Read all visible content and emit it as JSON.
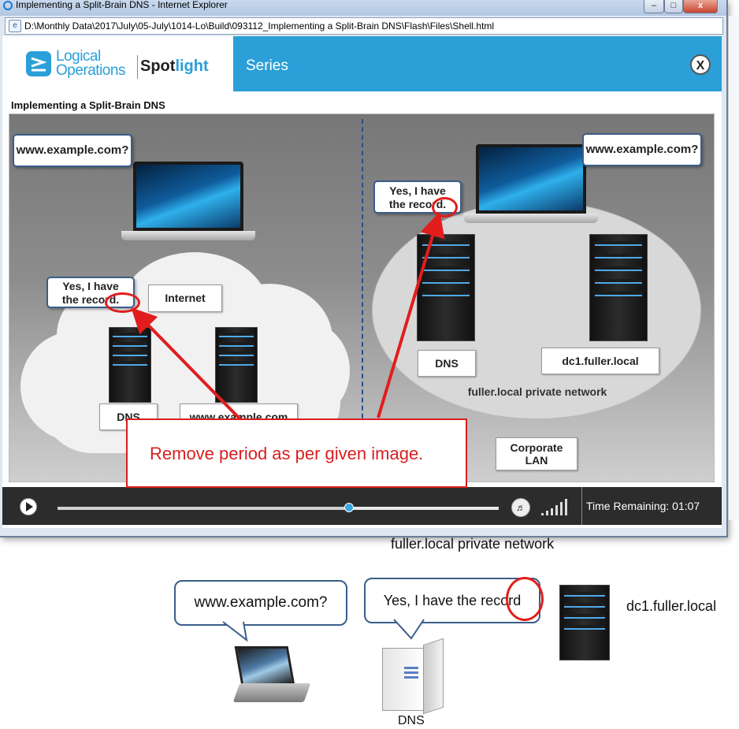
{
  "window": {
    "title": "Implementing a Split-Brain DNS - Internet Explorer",
    "address": "D:\\Monthly Data\\2017\\July\\05-July\\1014-Lo\\Build\\093112_Implementing a Split-Brain DNS\\Flash\\Files\\Shell.html",
    "buttons": {
      "minimize": "–",
      "maximize": "□",
      "close": "x"
    }
  },
  "player": {
    "logo": {
      "line1": "Logical",
      "line2": "Operations",
      "product_plain": "Spot",
      "product_accent": "light"
    },
    "header": {
      "series": "Series",
      "close": "X"
    },
    "course_title": "Implementing a Split-Brain DNS",
    "stage": {
      "left": {
        "query_bubble": "www.example.com?",
        "answer_bubble_line1": "Yes, I have",
        "answer_bubble_line2": "the record.",
        "internet_label": "Internet",
        "dns_label": "DNS",
        "server_label": "www.example.com"
      },
      "right": {
        "query_bubble": "www.example.com?",
        "answer_bubble_line1": "Yes, I have",
        "answer_bubble_line2": "the record.",
        "dns_label": "DNS",
        "dc_label": "dc1.fuller.local",
        "network_label": "fuller.local private network",
        "corp_line1": "Corporate",
        "corp_line2": "LAN"
      }
    },
    "controls": {
      "progress_fraction": 0.66,
      "time_remaining": "Time Remaining: 01:07"
    }
  },
  "annotation": {
    "text": "Remove period as per given image.",
    "color": "#d81f1f"
  },
  "reference": {
    "network_label": "fuller.local private network",
    "query_bubble": "www.example.com?",
    "answer_bubble": "Yes, I have the record",
    "dc_label": "dc1.fuller.local",
    "dns_label": "DNS"
  },
  "colors": {
    "accent": "#2a9fd8",
    "annotation": "#d81f1f",
    "control_bar": "#2c2c2c"
  },
  "icons": [
    "ie-page-icon",
    "close-icon",
    "play-icon",
    "volume-icon",
    "volume-level-icon"
  ]
}
